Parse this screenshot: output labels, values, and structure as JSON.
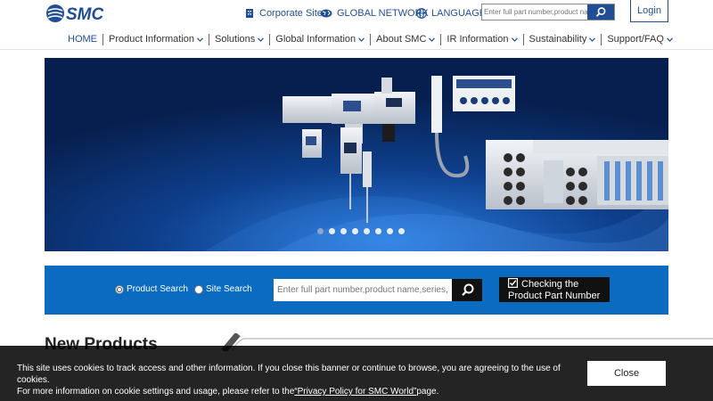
{
  "header": {
    "logo_text": "SMC",
    "corporate_site": "Corporate Site",
    "global_network": "GLOBAL NETWORK",
    "language": "LANGUAGE",
    "search_placeholder": "Enter full part number,product name,series,",
    "login": "Login"
  },
  "nav": {
    "items": [
      {
        "label": "HOME"
      },
      {
        "label": "Product Information"
      },
      {
        "label": "Solutions"
      },
      {
        "label": "Global Information"
      },
      {
        "label": "About SMC"
      },
      {
        "label": "IR Information"
      },
      {
        "label": "Sustainability"
      },
      {
        "label": "Support/FAQ"
      }
    ]
  },
  "hero": {
    "slide_count": 8,
    "active_slide": 1
  },
  "search_band": {
    "radio_product": "Product Search",
    "radio_site": "Site Search",
    "selected": "Product Search",
    "placeholder": "Enter full part number,product name,series,",
    "checking_line1": "Checking the",
    "checking_line2": "Product Part Number"
  },
  "new_products": {
    "title": "New Products"
  },
  "cookie": {
    "line1": "This site uses cookies to track access and other information. If you close this banner or continue to browse, you are agreeing to the use of cookies.",
    "line2_before": "For more information on cookie settings and usage, please refer to the",
    "link": "“Privacy Policy for SMC World”",
    "line2_after": "page.",
    "close": "Close"
  },
  "colors": {
    "brand_blue": "#1f4e96",
    "band_blue": "#0a6bc1",
    "hero_dark": "#0b2f6e"
  }
}
